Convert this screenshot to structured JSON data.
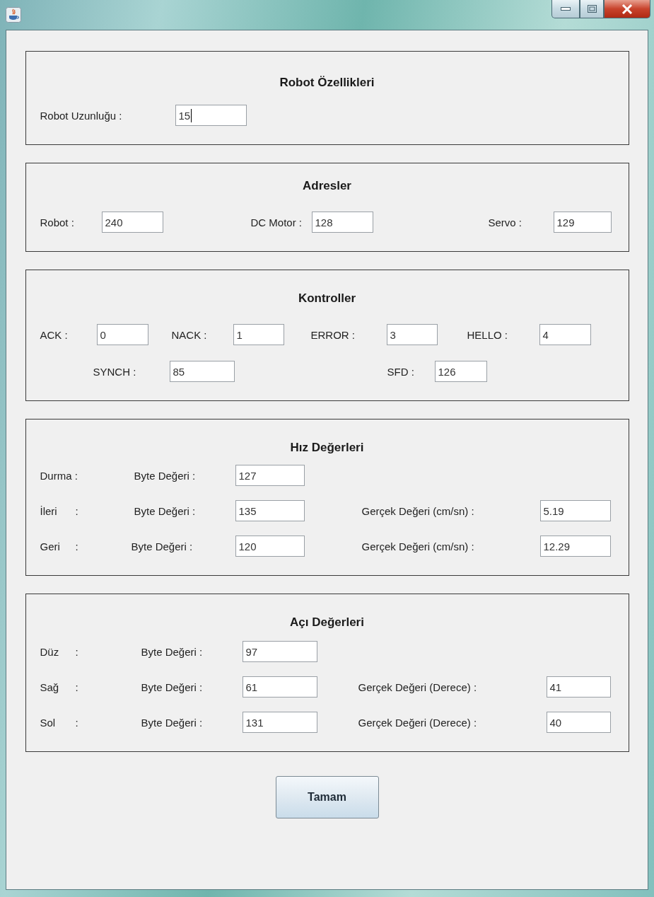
{
  "panels": [
    {
      "kind": "fields",
      "title": "Robot Özellikleri",
      "fields": [
        {
          "label": "Robot Uzunluğu :",
          "value": "15",
          "focused": true
        }
      ]
    },
    {
      "kind": "fields",
      "title": "Adresler",
      "fields": [
        {
          "label": "Robot :",
          "value": "240",
          "focused": false
        },
        {
          "label": "DC Motor :",
          "value": "128",
          "focused": false
        },
        {
          "label": "Servo :",
          "value": "129",
          "focused": false
        }
      ]
    },
    {
      "kind": "fields",
      "title": "Kontroller",
      "fields": [
        {
          "label": "ACK :",
          "value": "0",
          "focused": false
        },
        {
          "label": "NACK :",
          "value": "1",
          "focused": false
        },
        {
          "label": "ERROR :",
          "value": "3",
          "focused": false
        },
        {
          "label": "HELLO :",
          "value": "4",
          "focused": false
        },
        {
          "label": "SYNCH :",
          "value": "85",
          "focused": false
        },
        {
          "label": "SFD :",
          "value": "126",
          "focused": false
        }
      ]
    },
    {
      "kind": "readings",
      "title": "Hız Değerleri",
      "readings": [
        {
          "name": "Durma :",
          "byte_label": "Byte Değeri :",
          "byte_value": "127"
        },
        {
          "name": "İleri",
          "separator": ":",
          "byte_label": "Byte Değeri :",
          "byte_value": "135",
          "real_label": "Gerçek Değeri (cm/sn) :",
          "real_value": "5.19"
        },
        {
          "name": "Geri",
          "separator": ":",
          "byte_label": "Byte Değeri :",
          "byte_value": "120",
          "real_label": "Gerçek Değeri (cm/sn) :",
          "real_value": "12.29"
        }
      ]
    },
    {
      "kind": "readings",
      "title": "Açı Değerleri",
      "readings": [
        {
          "name": "Düz",
          "separator": ":",
          "byte_label": "Byte Değeri :",
          "byte_value": "97"
        },
        {
          "name": "Sağ",
          "separator": ":",
          "byte_label": "Byte Değeri :",
          "byte_value": "61",
          "real_label": "Gerçek Değeri (Derece) :",
          "real_value": "41"
        },
        {
          "name": "Sol",
          "separator": ":",
          "byte_label": "Byte Değeri :",
          "byte_value": "131",
          "real_label": "Gerçek Değeri (Derece) :",
          "real_value": "40"
        }
      ]
    }
  ],
  "buttons": [
    {
      "label": "Tamam"
    }
  ]
}
